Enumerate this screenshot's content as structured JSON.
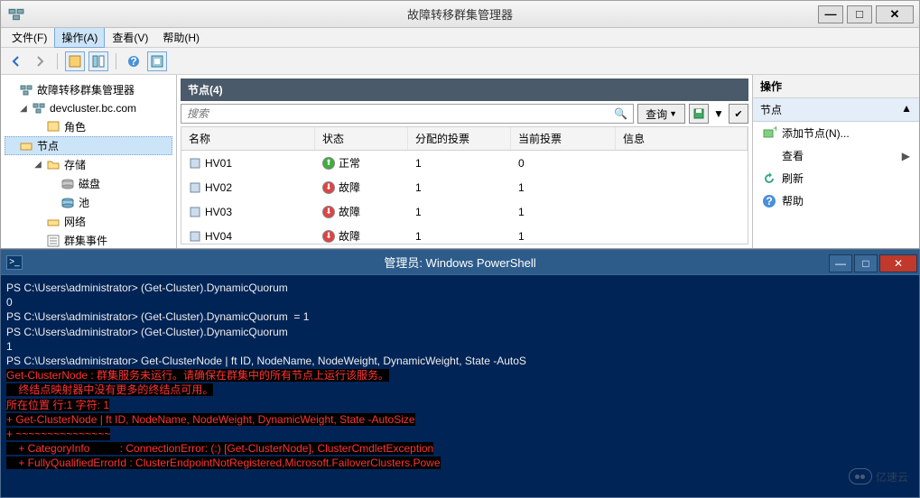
{
  "window": {
    "title": "故障转移群集管理器"
  },
  "menu": {
    "file": "文件(F)",
    "action": "操作(A)",
    "view": "查看(V)",
    "help": "帮助(H)"
  },
  "tree": {
    "root": "故障转移群集管理器",
    "cluster": "devcluster.bc.com",
    "roles": "角色",
    "nodes": "节点",
    "storage": "存储",
    "disks": "磁盘",
    "pools": "池",
    "networks": "网络",
    "events": "群集事件"
  },
  "center": {
    "header": "节点(4)",
    "search_placeholder": "搜索",
    "query_btn": "查询",
    "columns": {
      "name": "名称",
      "status": "状态",
      "assigned_vote": "分配的投票",
      "current_vote": "当前投票",
      "info": "信息"
    },
    "status_labels": {
      "ok": "正常",
      "fault": "故障"
    },
    "rows": [
      {
        "name": "HV01",
        "status": "ok",
        "assigned": "1",
        "current": "0",
        "info": ""
      },
      {
        "name": "HV02",
        "status": "fault",
        "assigned": "1",
        "current": "1",
        "info": ""
      },
      {
        "name": "HV03",
        "status": "fault",
        "assigned": "1",
        "current": "1",
        "info": ""
      },
      {
        "name": "HV04",
        "status": "fault",
        "assigned": "1",
        "current": "1",
        "info": ""
      }
    ]
  },
  "actions": {
    "title": "操作",
    "section": "节点",
    "add_node": "添加节点(N)...",
    "view": "查看",
    "refresh": "刷新",
    "help": "帮助"
  },
  "ps": {
    "title": "管理员: Windows PowerShell",
    "lines": [
      "",
      "PS C:\\Users\\administrator> (Get-Cluster).DynamicQuorum",
      "0",
      "PS C:\\Users\\administrator> (Get-Cluster).DynamicQuorum  = 1",
      "PS C:\\Users\\administrator> (Get-Cluster).DynamicQuorum",
      "1",
      "PS C:\\Users\\administrator> Get-ClusterNode | ft ID, NodeName, NodeWeight, DynamicWeight, State -AutoS"
    ],
    "err": [
      "Get-ClusterNode : 群集服务未运行。请确保在群集中的所有节点上运行该服务。",
      "    终结点映射器中没有更多的终结点可用。",
      "所在位置 行:1 字符: 1",
      "+ Get-ClusterNode | ft ID, NodeName, NodeWeight, DynamicWeight, State -AutoSize",
      "+ ~~~~~~~~~~~~~~~",
      "    + CategoryInfo          : ConnectionError: (:) [Get-ClusterNode], ClusterCmdletException",
      "    + FullyQualifiedErrorId : ClusterEndpointNotRegistered,Microsoft.FailoverClusters.Powe"
    ]
  },
  "watermark": "亿速云"
}
